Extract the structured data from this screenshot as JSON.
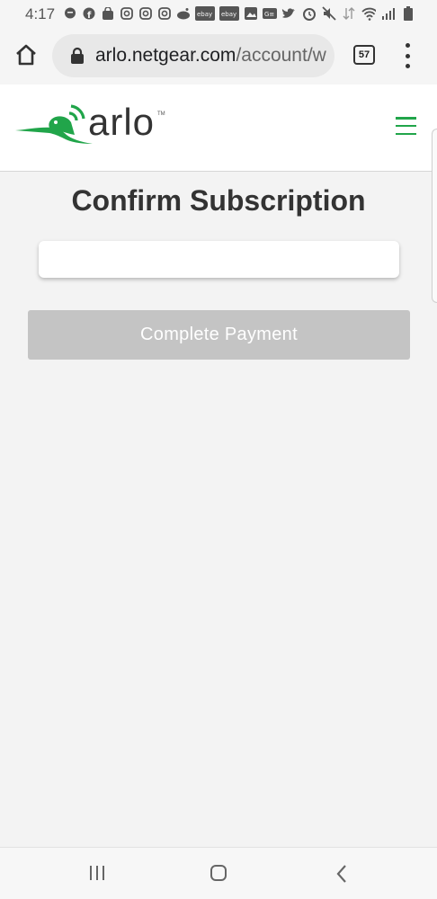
{
  "status_bar": {
    "time": "4:17",
    "left_icons": [
      "messenger-icon",
      "facebook-icon",
      "shopping-bag-icon",
      "instagram-icon",
      "instagram-icon",
      "instagram-icon",
      "reddit-icon",
      "ebay-icon",
      "ebay-icon",
      "gallery-icon",
      "news-icon",
      "twitter-icon"
    ],
    "ebay_label": "ebay",
    "ge_label": "G≡",
    "right_icons": [
      "alarm-icon",
      "mute-icon",
      "data-icon",
      "wifi-icon",
      "signal-icon",
      "battery-icon"
    ]
  },
  "browser": {
    "url_host": "arlo.netgear.com",
    "url_path": "/account/w",
    "tab_count": "57"
  },
  "header": {
    "brand": "arlo",
    "trademark": "TM",
    "brand_color": "#21a54a"
  },
  "main": {
    "title": "Confirm Subscription",
    "pay_button_label": "Complete Payment"
  },
  "colors": {
    "accent": "#21a54a",
    "disabled_button": "#c4c4c4"
  }
}
